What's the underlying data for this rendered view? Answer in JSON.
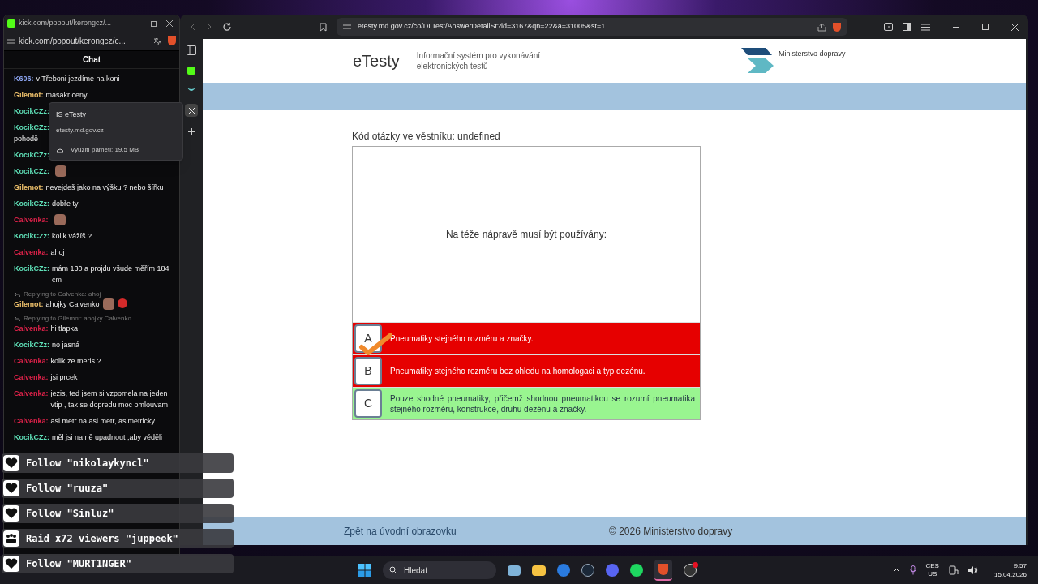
{
  "chat_window": {
    "title": "kick.com/popout/kerongcz/...",
    "url": "kick.com/popout/kerongcz/c...",
    "header": "Chat",
    "messages": [
      {
        "user": "K606:",
        "color": "#8ea7f5",
        "text": "v Třeboni jezdíme na koni"
      },
      {
        "user": "Gilemot:",
        "color": "#f2c46d",
        "text": "masakr ceny"
      },
      {
        "user": "KocikCZz:",
        "color": "#5fe0b8"
      },
      {
        "user": "KocikCZz:",
        "color": "#5fe0b8",
        "text": "pohodě",
        "kind": "wrapped"
      },
      {
        "user": "KocikCZz:",
        "color": "#5fe0b8"
      },
      {
        "user": "KocikCZz:",
        "color": "#5fe0b8",
        "kind": "emote"
      },
      {
        "user": "Gilemot:",
        "color": "#f2c46d",
        "text": "nevejdeš jako na výšku ? nebo šířku"
      },
      {
        "user": "KocikCZz:",
        "color": "#5fe0b8",
        "text": "dobře ty"
      },
      {
        "user": "Calvenka:",
        "color": "#e0224a",
        "kind": "emote"
      },
      {
        "user": "KocikCZz:",
        "color": "#5fe0b8",
        "text": "kolik vážíš ?"
      },
      {
        "user": "Calvenka:",
        "color": "#e0224a",
        "text": "ahoj"
      },
      {
        "user": "KocikCZz:",
        "color": "#5fe0b8",
        "text": "mám 130 a projdu všude měřím 184 cm"
      },
      {
        "user": "Gilemot:",
        "color": "#f2c46d",
        "text": "ahojky Calvenko",
        "reply": "Replying to Calvenka: ahoj",
        "kind": "emote"
      },
      {
        "user": "Calvenka:",
        "color": "#e0224a",
        "text": "hi tlapka",
        "reply": "Replying to Gilemot: ahojky Calvenko"
      },
      {
        "user": "KocikCZz:",
        "color": "#5fe0b8",
        "text": "no jasná"
      },
      {
        "user": "Calvenka:",
        "color": "#e0224a",
        "text": "kolik ze meris ?"
      },
      {
        "user": "Calvenka:",
        "color": "#e0224a",
        "text": "jsi prcek"
      },
      {
        "user": "Calvenka:",
        "color": "#e0224a",
        "text": "jezis, ted jsem si vzpomela na jeden vtip , tak se dopredu moc omlouvam"
      },
      {
        "user": "Calvenka:",
        "color": "#e0224a",
        "text": "asi metr na asi metr, asimetricky"
      },
      {
        "user": "KocikCZz:",
        "color": "#5fe0b8",
        "text": "měl jsi na ně upadnout ,aby věděli"
      }
    ]
  },
  "tab_tooltip": {
    "title": "IS eTesty",
    "domain": "etesty.md.gov.cz",
    "memory": "Využití paměti: 19,5 MB"
  },
  "alerts": [
    {
      "kind": "follow",
      "text": "Follow \"nikolaykyncl\""
    },
    {
      "kind": "follow",
      "text": "Follow \"ruuza\""
    },
    {
      "kind": "follow",
      "text": "Follow \"Sinluz\""
    },
    {
      "kind": "raid",
      "text": "Raid x72 viewers \"juppeek\""
    },
    {
      "kind": "follow",
      "text": "Follow \"MURT1NGER\""
    }
  ],
  "browser": {
    "url": "etesty.md.gov.cz/co/DLTest/AnswerDetailSt?id=3167&qn=22&a=31005&st=1"
  },
  "page": {
    "brand": "eTesty",
    "brand_subtitle": "Informační systém pro vykonávání elektronických testů",
    "ministry": "Ministerstvo dopravy",
    "question_code": "Kód otázky ve věstníku: undefined",
    "question": "Na téže nápravě musí být používány:",
    "answers": [
      {
        "letter": "A",
        "text": "Pneumatiky stejného rozměru a značky.",
        "kind": "wrong",
        "marked": true
      },
      {
        "letter": "B",
        "text": "Pneumatiky stejného rozměru bez ohledu na homologaci a typ dezénu.",
        "kind": "wrong",
        "marked": false
      },
      {
        "letter": "C",
        "text": "Pouze shodné pneumatiky, přičemž shodnou pneumatikou se rozumí pneumatika stejného rozměru, konstrukce, druhu dezénu a značky.",
        "kind": "correct",
        "marked": false
      }
    ],
    "footer_link": "Zpět na úvodní obrazovku",
    "copyright": "© 2026 Ministerstvo dopravy"
  },
  "taskbar": {
    "search_placeholder": "Hledat",
    "language": "CES",
    "layout": "US",
    "time": "9:57",
    "date": "15.04.2026"
  }
}
